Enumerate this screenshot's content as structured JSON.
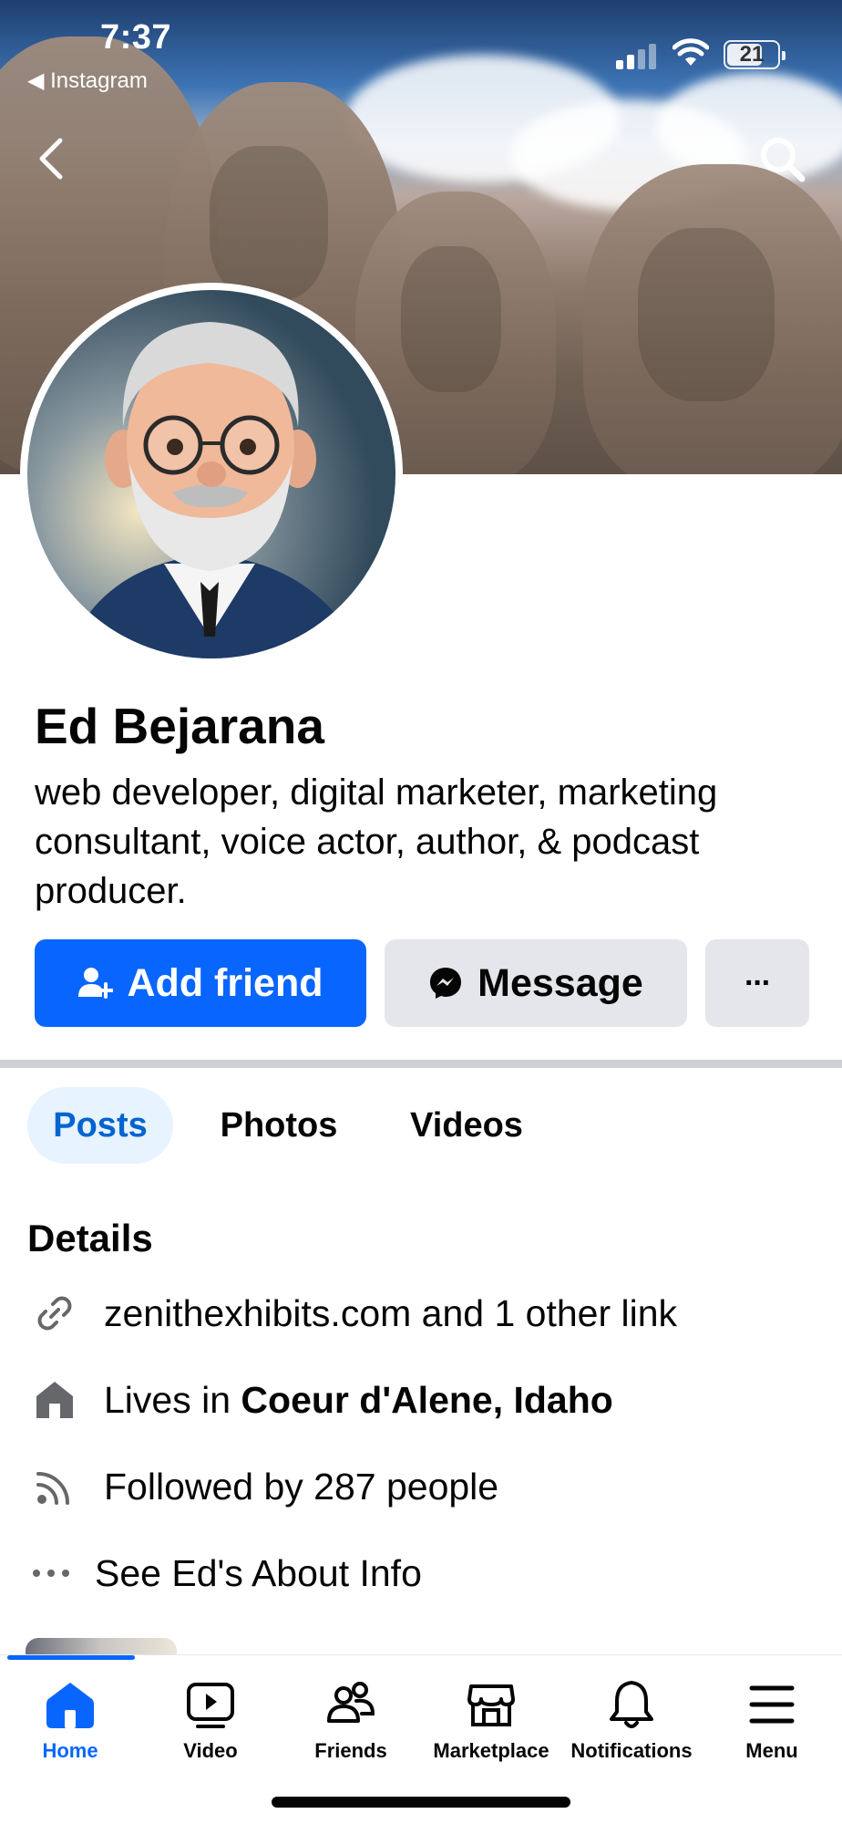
{
  "status_bar": {
    "time": "7:37",
    "back_app": "◀ Instagram",
    "battery": "21"
  },
  "profile": {
    "name": "Ed Bejarana",
    "bio": "web developer, digital marketer, marketing consultant, voice actor, author, & podcast producer."
  },
  "actions": {
    "add_friend": "Add friend",
    "message": "Message",
    "more": "···"
  },
  "tabs": [
    {
      "label": "Posts",
      "active": true
    },
    {
      "label": "Photos",
      "active": false
    },
    {
      "label": "Videos",
      "active": false
    }
  ],
  "details": {
    "title": "Details",
    "link": "zenithexhibits.com and 1 other link",
    "lives_prefix": "Lives in ",
    "lives_place": "Coeur d'Alene, Idaho",
    "followed": "Followed by 287 people",
    "about": "See Ed's About Info"
  },
  "bottom_nav": [
    {
      "label": "Home",
      "icon": "home-icon",
      "active": true
    },
    {
      "label": "Video",
      "icon": "video-icon",
      "active": false
    },
    {
      "label": "Friends",
      "icon": "friends-icon",
      "active": false
    },
    {
      "label": "Marketplace",
      "icon": "marketplace-icon",
      "active": false
    },
    {
      "label": "Notifications",
      "icon": "bell-icon",
      "active": false
    },
    {
      "label": "Menu",
      "icon": "menu-icon",
      "active": false
    }
  ],
  "colors": {
    "primary": "#0866ff",
    "tab_active_bg": "#e7f3ff",
    "tab_active_text": "#0064d1",
    "button_gray": "#e4e6eb"
  }
}
